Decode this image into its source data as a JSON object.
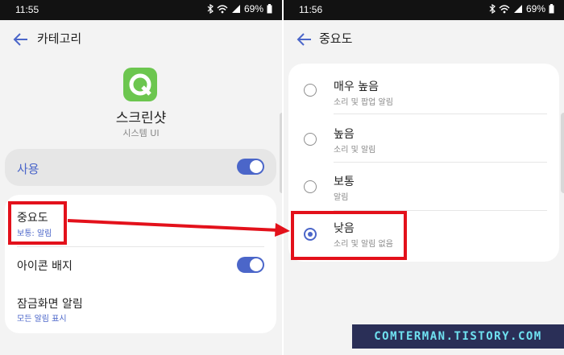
{
  "left": {
    "status": {
      "time": "11:55",
      "battery": "69%"
    },
    "title": "카테고리",
    "app": {
      "name": "스크린샷",
      "subtitle": "시스템 UI"
    },
    "use_toggle": {
      "label": "사용",
      "on": true
    },
    "importance": {
      "label": "중요도",
      "value": "보통: 알림"
    },
    "badge": {
      "label": "아이콘 배지",
      "on": true
    },
    "lockscreen": {
      "label": "잠금화면 알림",
      "value": "모든 알림 표시"
    }
  },
  "right": {
    "status": {
      "time": "11:56",
      "battery": "69%"
    },
    "title": "중요도",
    "options": [
      {
        "label": "매우 높음",
        "sub": "소리 및 팝업 알림",
        "selected": false
      },
      {
        "label": "높음",
        "sub": "소리 및 알림",
        "selected": false
      },
      {
        "label": "보통",
        "sub": "알림",
        "selected": false
      },
      {
        "label": "낮음",
        "sub": "소리 및 알림 없음",
        "selected": true
      }
    ]
  },
  "watermark": "COMTERMAN.TISTORY.COM",
  "colors": {
    "accent": "#4b66c9",
    "highlight": "#e3111b",
    "app_icon": "#6cc64f"
  }
}
